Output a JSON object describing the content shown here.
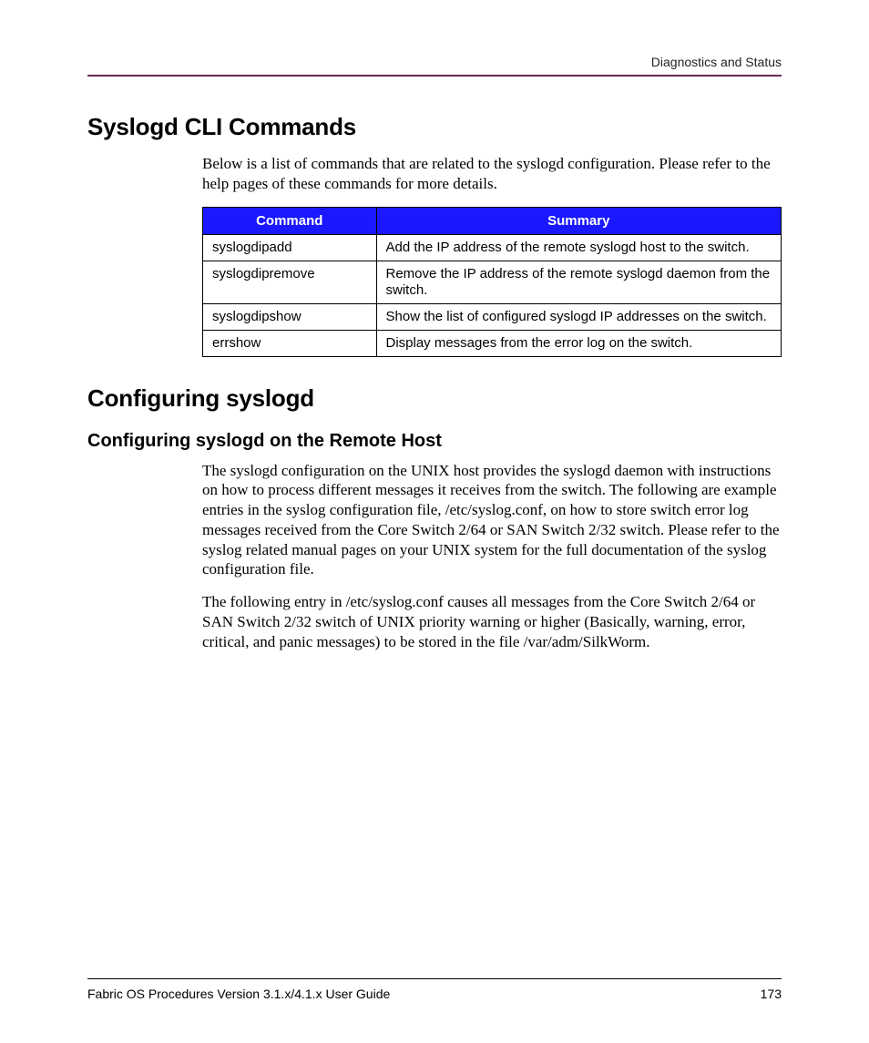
{
  "header": {
    "section": "Diagnostics and Status"
  },
  "section1": {
    "title": "Syslogd CLI Commands",
    "intro": "Below is a list of commands that are related to the syslogd configuration. Please refer to the help pages of these commands for more details.",
    "table": {
      "headers": {
        "col1": "Command",
        "col2": "Summary"
      },
      "rows": [
        {
          "cmd": "syslogdipadd",
          "summary": "Add the IP address of the remote syslogd host to the switch."
        },
        {
          "cmd": "syslogdipremove",
          "summary": "Remove the IP address of the remote syslogd daemon from the switch."
        },
        {
          "cmd": "syslogdipshow",
          "summary": "Show the list of configured syslogd IP addresses on the switch."
        },
        {
          "cmd": "errshow",
          "summary": "Display messages from the error log on the switch."
        }
      ]
    }
  },
  "section2": {
    "title": "Configuring syslogd",
    "sub": {
      "title": "Configuring syslogd on the Remote Host",
      "para1": "The syslogd configuration on the UNIX host provides the syslogd daemon with instructions on how to process different messages it receives from the switch. The following are example entries in the syslog configuration file, /etc/syslog.conf, on how to store switch error log messages received from the Core Switch 2/64 or SAN Switch 2/32 switch. Please refer to the syslog related manual pages on your UNIX system for the full documentation of the syslog configuration file.",
      "para2": "The following entry in /etc/syslog.conf causes all messages from the Core Switch 2/64 or SAN Switch 2/32 switch of UNIX priority warning or higher (Basically, warning, error, critical, and panic messages) to be stored in the file /var/adm/SilkWorm."
    }
  },
  "footer": {
    "left": "Fabric OS Procedures Version 3.1.x/4.1.x User Guide",
    "right": "173"
  }
}
